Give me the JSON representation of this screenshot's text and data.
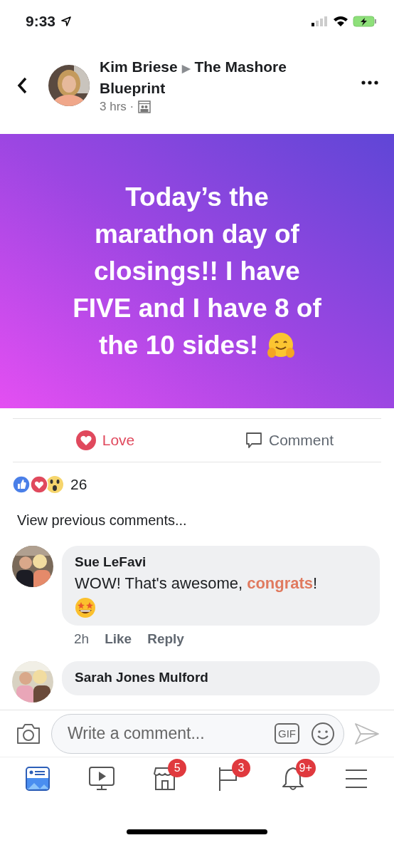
{
  "status_bar": {
    "time": "9:33"
  },
  "post_header": {
    "author": "Kim Briese",
    "separator": "▶",
    "group": "The Mashore Blueprint",
    "time": "3 hrs ·"
  },
  "post": {
    "text": "Today’s the\nmarathon day of\nclosings!! I have\nFIVE and I have 8 of",
    "text_end": "the 10 sides!"
  },
  "actions": [
    {
      "label": "Love",
      "selected": true
    },
    {
      "label": "Comment",
      "selected": false
    }
  ],
  "reactions": {
    "count": "26"
  },
  "view_previous": "View previous comments...",
  "comments": [
    {
      "name": "Sue LeFavi",
      "text": "WOW! That's awesome, **congrats**!",
      "emoji": true,
      "time": "2h",
      "like": "Like",
      "reply": "Reply"
    },
    {
      "name": "Sarah Jones Mulford"
    }
  ],
  "composer": {
    "placeholder": "Write a comment...",
    "gif": "GIF"
  },
  "tab_bar": [
    {
      "kind": "feed",
      "selected": true
    },
    {
      "kind": "video",
      "selected": false
    },
    {
      "kind": "shop",
      "selected": false,
      "badge": "5"
    },
    {
      "kind": "pages",
      "selected": false,
      "badge": "3"
    },
    {
      "kind": "bell",
      "selected": false,
      "badge": "9+"
    },
    {
      "kind": "menu",
      "selected": false
    }
  ]
}
